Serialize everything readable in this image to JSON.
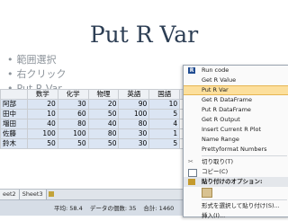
{
  "slide": {
    "title": "Put R Var",
    "bullets": [
      "範囲選択",
      "右クリック",
      "Put R Var"
    ]
  },
  "sheet": {
    "columns": [
      "",
      "数学",
      "化学",
      "物理",
      "英語",
      "国語",
      ""
    ],
    "rows": [
      {
        "name": "阿部",
        "values": [
          "20",
          "30",
          "20",
          "90",
          "10"
        ]
      },
      {
        "name": "田中",
        "values": [
          "10",
          "60",
          "50",
          "100",
          "5"
        ]
      },
      {
        "name": "増田",
        "values": [
          "40",
          "80",
          "40",
          "80",
          "4"
        ]
      },
      {
        "name": "佐藤",
        "values": [
          "100",
          "100",
          "80",
          "30",
          "1"
        ]
      },
      {
        "name": "鈴木",
        "values": [
          "50",
          "50",
          "50",
          "30",
          "5"
        ]
      }
    ],
    "tabs": [
      "eet2",
      "Sheet3"
    ],
    "status": {
      "average": "平均: 58.4",
      "count": "データの個数: 35",
      "sum": "合計: 1460"
    }
  },
  "context_menu": {
    "items": [
      {
        "label": "Run code",
        "icon": "r-icon"
      },
      {
        "label": "Get R Value"
      },
      {
        "label": "Put R Var",
        "active": true
      },
      {
        "label": "Get R DataFrame"
      },
      {
        "label": "Put R DataFrame"
      },
      {
        "label": "Get R Output"
      },
      {
        "label": "Insert Current R Plot"
      },
      {
        "label": "Name Range"
      },
      {
        "label": "Prettyformat Numbers"
      },
      {
        "label": "切り取り(T)",
        "icon": "scissors-icon"
      },
      {
        "label": "コピー(C)",
        "icon": "copy-icon"
      },
      {
        "label": "貼り付けのオプション:",
        "icon": "paste-icon",
        "section": true
      },
      {
        "label": "形式を選択して貼り付け(S)..."
      },
      {
        "label": "挿入(I)..."
      }
    ]
  },
  "colors": {
    "title": "#2d3e54",
    "menu_highlight": "#fcdf9c",
    "selection": "#dbe5f3"
  }
}
